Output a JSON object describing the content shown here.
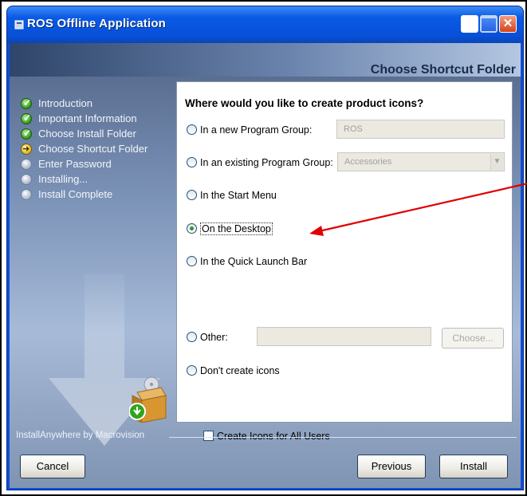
{
  "window": {
    "title": "ROS Offline Application",
    "header": "Choose Shortcut Folder"
  },
  "steps": [
    {
      "label": "Introduction",
      "state": "done"
    },
    {
      "label": "Important Information",
      "state": "done"
    },
    {
      "label": "Choose Install Folder",
      "state": "done"
    },
    {
      "label": "Choose Shortcut Folder",
      "state": "current"
    },
    {
      "label": "Enter Password",
      "state": "pending"
    },
    {
      "label": "Installing...",
      "state": "pending"
    },
    {
      "label": "Install Complete",
      "state": "pending"
    }
  ],
  "content": {
    "question": "Where would you like to create product icons?",
    "options": {
      "new_group": "In a new Program Group:",
      "existing_group": "In an existing Program Group:",
      "start_menu": "In the Start Menu",
      "desktop": "On the Desktop",
      "quick_launch": "In the Quick Launch Bar",
      "other": "Other:",
      "none": "Don't create icons"
    },
    "selected": "desktop",
    "new_group_value": "ROS",
    "existing_group_value": "Accessories",
    "choose_label": "Choose...",
    "all_users_label": "Create Icons for All Users"
  },
  "footer": {
    "brand": "InstallAnywhere by Macrovision",
    "cancel": "Cancel",
    "previous": "Previous",
    "install": "Install"
  },
  "colors": {
    "title_bar": "#0a5ae6",
    "annotation_arrow": "#e00000",
    "selected_radio": "#2b9a20"
  }
}
